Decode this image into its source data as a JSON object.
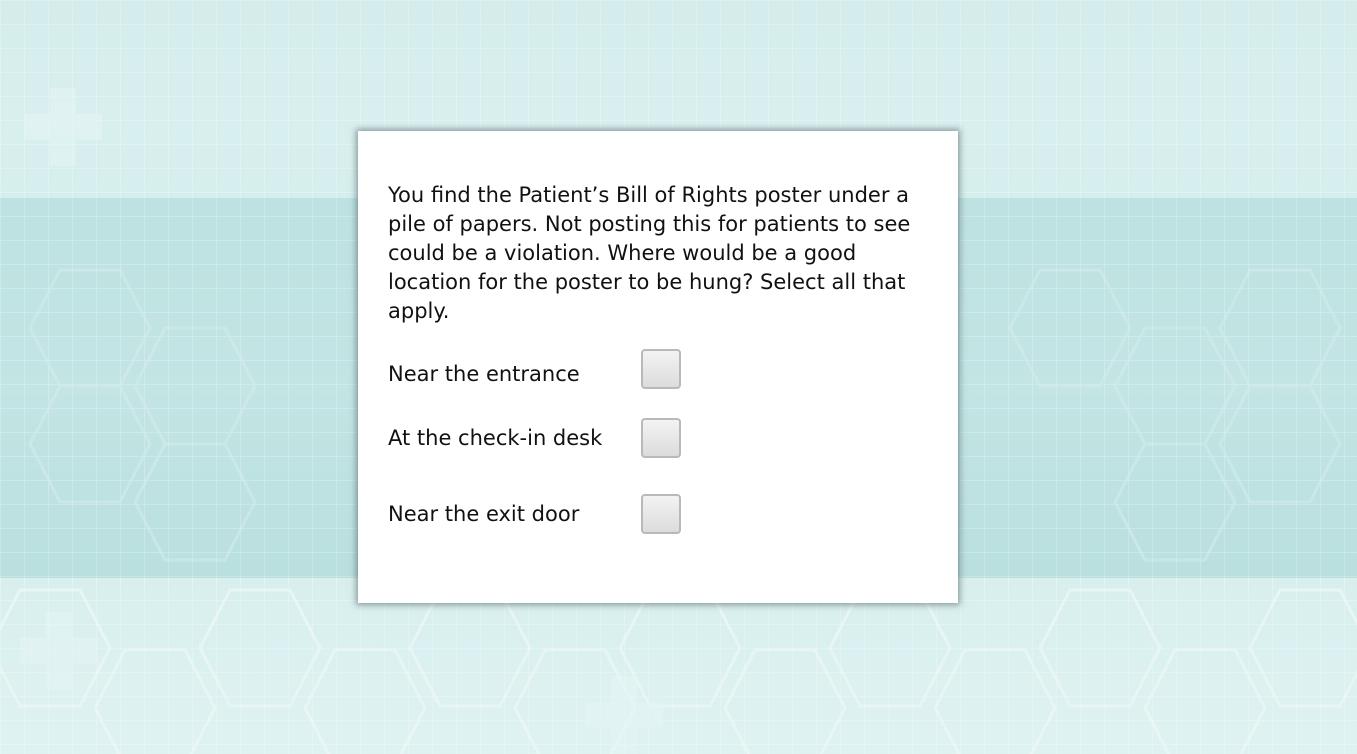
{
  "question": "You find the Patient’s Bill of Rights poster under a pile of papers. Not posting this for patients to see could be a violation. Where would be a good location for the poster to be hung? Select all that apply.",
  "options": [
    {
      "label": "Near the entrance",
      "checked": false
    },
    {
      "label": "At the check-in desk",
      "checked": false
    },
    {
      "label": "Near the exit door",
      "checked": false
    }
  ],
  "colors": {
    "background": "#cbe7e6",
    "card": "#ffffff",
    "checkbox_border": "#b9b9b9"
  }
}
